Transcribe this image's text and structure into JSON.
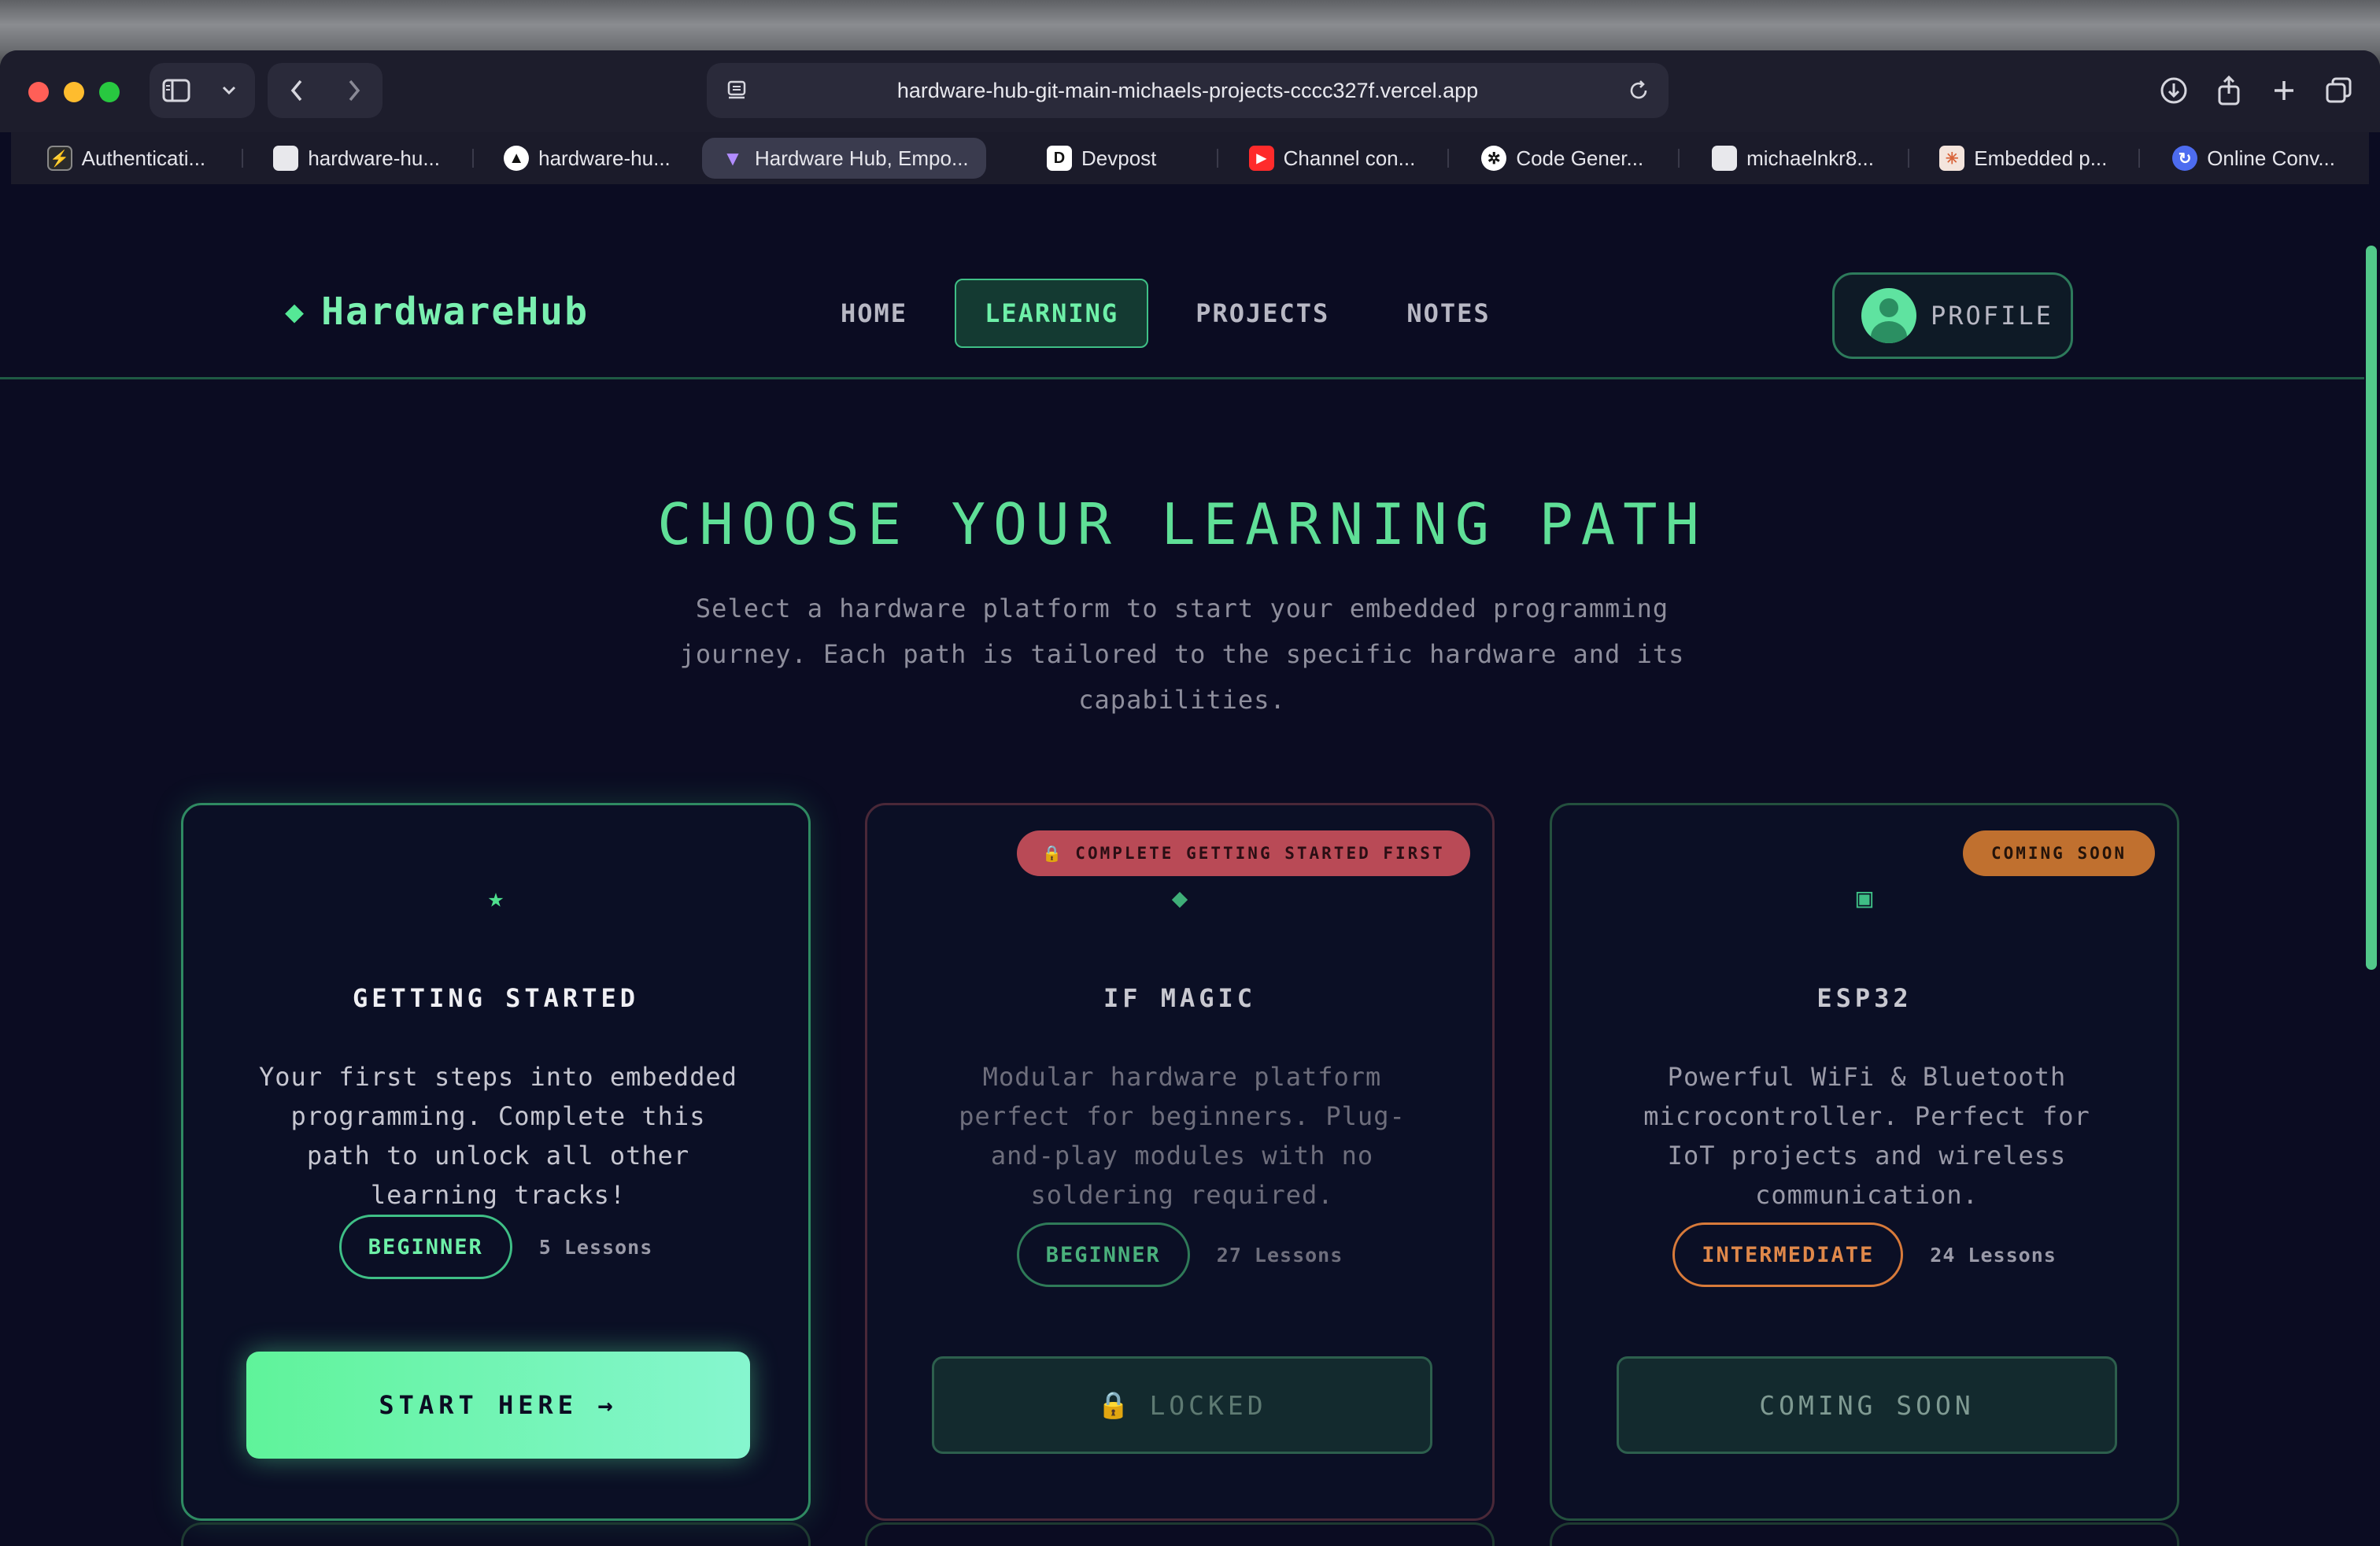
{
  "browser": {
    "url": "hardware-hub-git-main-michaels-projects-cccc327f.vercel.app",
    "tabs": [
      {
        "label": "Authenticati...",
        "favicon": "bolt-icon",
        "favicon_bg": "#2b2b2b"
      },
      {
        "label": "hardware-hu...",
        "favicon": "page-icon",
        "favicon_bg": "#e8e8ec"
      },
      {
        "label": "hardware-hu...",
        "favicon": "triangle-icon",
        "favicon_bg": "#ffffff"
      },
      {
        "label": "Hardware Hub, Empo...",
        "favicon": "vite-icon",
        "favicon_bg": "#3a3b4e",
        "active": true
      },
      {
        "label": "Devpost",
        "favicon": "devpost-icon",
        "favicon_bg": "#ffffff"
      },
      {
        "label": "Channel con...",
        "favicon": "youtube-icon",
        "favicon_bg": "#ff2b2b"
      },
      {
        "label": "Code Gener...",
        "favicon": "openai-icon",
        "favicon_bg": "#ffffff"
      },
      {
        "label": "michaelnkr8...",
        "favicon": "github-icon",
        "favicon_bg": "#e8e8ec"
      },
      {
        "label": "Embedded p...",
        "favicon": "claude-icon",
        "favicon_bg": "#f4e4dc"
      },
      {
        "label": "Online Conv...",
        "favicon": "convert-icon",
        "favicon_bg": "#4d6cf0"
      }
    ]
  },
  "site": {
    "logo": "HardwareHub",
    "nav": [
      "HOME",
      "LEARNING",
      "PROJECTS",
      "NOTES"
    ],
    "active_nav": "LEARNING",
    "profile_label": "PROFILE"
  },
  "hero": {
    "title": "CHOOSE YOUR LEARNING PATH",
    "subtitle": "Select a hardware platform to start your embedded programming journey. Each path is tailored to the specific hardware and its capabilities."
  },
  "cards": [
    {
      "icon": "★",
      "title": "GETTING STARTED",
      "description": "Your first steps into embedded programming. Complete this path to unlock all other learning tracks!",
      "level": "BEGINNER",
      "lessons": "5 Lessons",
      "button": "START HERE →",
      "status": "available"
    },
    {
      "icon": "◆",
      "title": "IF MAGIC",
      "description": "Modular hardware platform perfect for beginners. Plug-and-play modules with no soldering required.",
      "level": "BEGINNER",
      "lessons": "27 Lessons",
      "button": "LOCKED",
      "badge": "COMPLETE GETTING STARTED FIRST",
      "status": "locked"
    },
    {
      "icon": "▣",
      "title": "ESP32",
      "description": "Powerful WiFi & Bluetooth microcontroller. Perfect for IoT projects and wireless communication.",
      "level": "INTERMEDIATE",
      "lessons": "24 Lessons",
      "button": "COMING SOON",
      "badge": "COMING SOON",
      "status": "coming-soon"
    }
  ],
  "colors": {
    "accent_green": "#5fdf97",
    "page_bg": "#0b0c22",
    "locked_badge": "#b94a56",
    "coming_soon_badge": "#c0702f"
  }
}
